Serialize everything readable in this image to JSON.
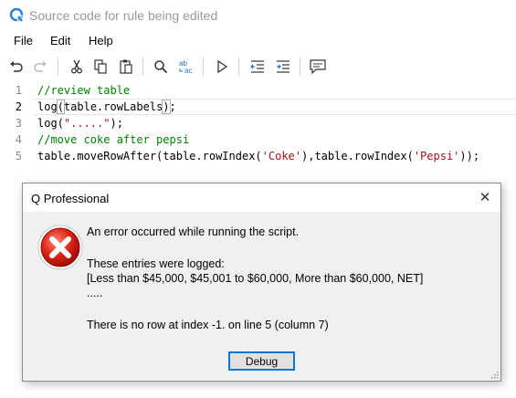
{
  "window": {
    "title": "Source code for rule being edited"
  },
  "menu": [
    "File",
    "Edit",
    "Help"
  ],
  "toolbar": {
    "icons": [
      "undo-icon",
      "redo-icon",
      "cut-icon",
      "copy-icon",
      "paste-icon",
      "find-icon",
      "replace-icon",
      "run-icon",
      "outdent-icon",
      "indent-icon",
      "comment-icon"
    ]
  },
  "editor": {
    "current_line": 2,
    "lines": [
      {
        "num": "1",
        "text": "//review table"
      },
      {
        "num": "2",
        "text_a": "log",
        "text_b": "(",
        "text_c": "table.rowLabels",
        "text_d": ")",
        "text_e": ";"
      },
      {
        "num": "3",
        "text_a": "log(",
        "str": "\".....\"",
        "text_b": ");"
      },
      {
        "num": "4",
        "text": "//move coke after pepsi"
      },
      {
        "num": "5",
        "text_a": "table.moveRowAfter(table.rowIndex(",
        "str1": "'Coke'",
        "text_b": "),table.rowIndex(",
        "str2": "'Pepsi'",
        "text_c": "));"
      }
    ]
  },
  "dialog": {
    "title": "Q Professional",
    "close_glyph": "✕",
    "message": "An error occurred while running the script.",
    "logged_header": "These entries were logged:",
    "logged_entry": "[Less than $45,000, $45,001 to $60,000, More than $60,000, NET]",
    "logged_more": ".....",
    "error_detail": "There is no row at index -1. on line 5 (column 7)",
    "debug_label": "Debug"
  }
}
